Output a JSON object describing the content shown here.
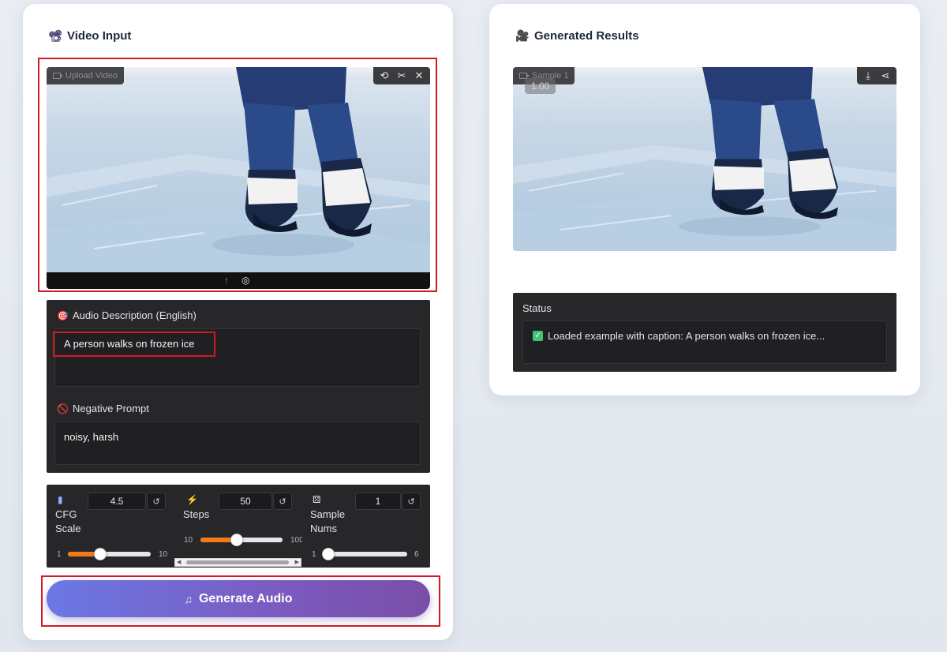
{
  "left_card": {
    "title": "Video Input",
    "title_icon": "film-projector-icon",
    "video": {
      "label": "Upload Video",
      "tools": [
        "undo-icon",
        "scissors-icon",
        "close-icon"
      ]
    },
    "audio_description": {
      "label": "Audio Description (English)",
      "icon": "dart-icon",
      "value": "A person walks on frozen ice"
    },
    "negative_prompt": {
      "label": "Negative Prompt",
      "icon": "prohibited-icon",
      "value": "noisy, harsh"
    },
    "params": {
      "cfg": {
        "label_line1": "CFG",
        "label_line2": "Scale",
        "value": "4.5",
        "min": "1",
        "max": "10",
        "level": 0.39,
        "icon": "ruler-icon"
      },
      "steps": {
        "label": "Steps",
        "value": "50",
        "min": "10",
        "max": "100",
        "level": 0.44,
        "icon": "lightning-icon"
      },
      "samples": {
        "label_line1": "Sample",
        "label_line2": "Nums",
        "value": "1",
        "min": "1",
        "max": "6",
        "level": 0.0,
        "icon": "dice-icon"
      },
      "reset_glyph": "↺"
    },
    "generate_button": {
      "label": "Generate Audio",
      "icon": "music-note-icon"
    }
  },
  "right_card": {
    "title": "Generated Results",
    "title_icon": "movie-camera-icon",
    "video": {
      "label": "Sample 1",
      "speed": "1.00",
      "tools": [
        "download-icon",
        "share-icon"
      ]
    },
    "status": {
      "label": "Status",
      "text": "Loaded example with caption: A person walks on frozen ice..."
    }
  },
  "colors": {
    "accent_orange": "#f27a1a",
    "button_gradient_start": "#6b78e4",
    "button_gradient_end": "#7a4ea8",
    "highlight_red": "#d11a24",
    "panel_dark": "#27272a"
  }
}
